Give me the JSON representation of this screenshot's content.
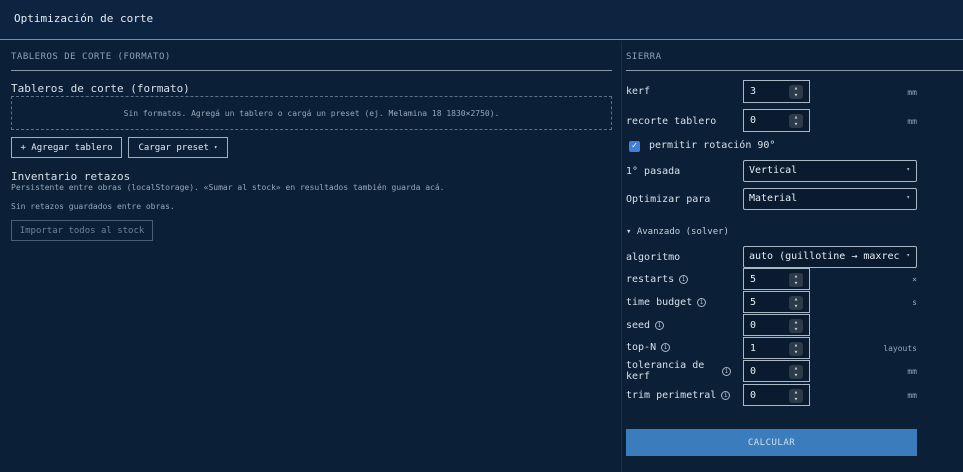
{
  "window": {
    "title": "Optimización de corte"
  },
  "left": {
    "section_title": "TABLEROS DE CORTE (FORMATO)",
    "boards_title": "Tableros de corte (formato)",
    "empty_text": "Sin formatos. Agregá un tablero o cargá un preset (ej. Melamina 18 1830×2750).",
    "add_board": "+ Agregar tablero",
    "load_preset": "Cargar preset",
    "load_preset_caret": "▾",
    "inventory_title": "Inventario retazos",
    "inventory_note": "Persistente entre obras (localStorage). «Sumar al stock» en resultados también guarda acá.",
    "inventory_empty": "Sin retazos guardados entre obras.",
    "import_all": "Importar todos al stock"
  },
  "right": {
    "section_title": "SIERRA",
    "kerf": {
      "label": "kerf",
      "value": "3",
      "unit": "mm"
    },
    "trim": {
      "label": "recorte tablero",
      "value": "0",
      "unit": "mm"
    },
    "rotation": {
      "label": "permitir rotación 90°",
      "checked": true
    },
    "first_pass": {
      "label": "1° pasada",
      "value": "Vertical"
    },
    "optimize_for": {
      "label": "Optimizar para",
      "value": "Material"
    },
    "advanced": {
      "label": "▾ Avanzado (solver)"
    },
    "algorithm": {
      "label": "algoritmo",
      "value": "auto (guillotine → maxrec…"
    },
    "restarts": {
      "label": "restarts",
      "value": "5",
      "unit": "×"
    },
    "time_budget": {
      "label": "time budget",
      "value": "5",
      "unit": "s"
    },
    "seed": {
      "label": "seed",
      "value": "0",
      "unit": ""
    },
    "top_n": {
      "label": "top-N",
      "value": "1",
      "unit": "layouts"
    },
    "kerf_tolerance": {
      "label_1": "tolerancia de",
      "label_2": "kerf",
      "value": "0",
      "unit": "mm"
    },
    "trim_perimeter": {
      "label": "trim perimetral",
      "value": "0",
      "unit": "mm"
    },
    "calculate": "CALCULAR"
  },
  "icons": {
    "info": "i",
    "spin_up": "▴",
    "spin_down": "▾",
    "caret": "▾",
    "check": "✓"
  },
  "colors": {
    "background": "#0b1f36",
    "accent": "#3a7cbc",
    "checkbox": "#3d7fd9"
  }
}
